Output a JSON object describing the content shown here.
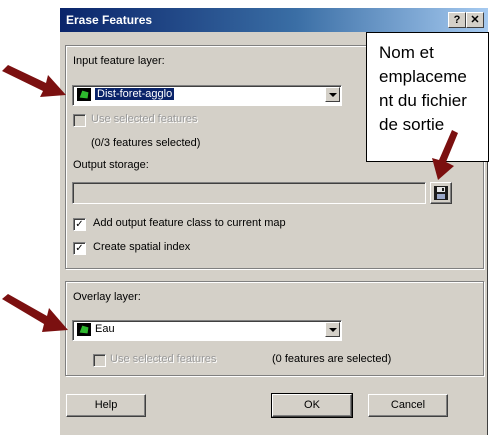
{
  "window": {
    "title": "Erase Features",
    "help_btn": "?",
    "close_btn": "✕"
  },
  "input": {
    "label": "Input feature layer:",
    "selected": "Dist-foret-agglo",
    "use_selected": "Use selected features",
    "count": "(0/3 features selected)"
  },
  "output": {
    "label": "Output storage:",
    "value": "",
    "add_to_map": "Add output feature class to current map",
    "add_to_map_checked": true,
    "spatial_index": "Create spatial index",
    "spatial_index_checked": true
  },
  "overlay": {
    "label": "Overlay layer:",
    "selected": "Eau",
    "use_selected": "Use selected features",
    "count": "(0 features are selected)"
  },
  "buttons": {
    "help": "Help",
    "ok": "OK",
    "cancel": "Cancel"
  },
  "callout": {
    "text": "Nom et\nemplaceme\nnt du fichier\nde sortie"
  },
  "colors": {
    "arrow": "#7b1010",
    "titlebar": "#0a246a",
    "dialog": "#d4d0c8",
    "layer_icon": "#2eb82e"
  },
  "icons": {
    "layer": "polygon-layer-icon",
    "save": "floppy-disk-icon",
    "pointer": "red-arrow-icon"
  }
}
